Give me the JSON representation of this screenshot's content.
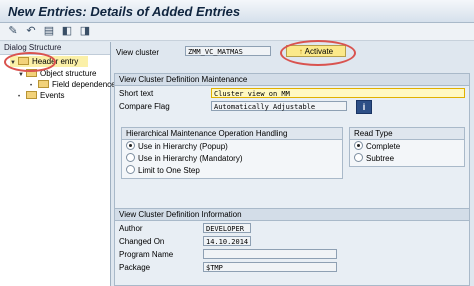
{
  "window": {
    "title": "New Entries: Details of Added Entries"
  },
  "toolbar": {
    "icons": [
      "pencil-icon",
      "back-icon",
      "pages-icon",
      "prev-icon",
      "next-icon"
    ]
  },
  "dialog_structure": {
    "title": "Dialog Structure",
    "items": [
      {
        "label": "Header entry"
      },
      {
        "label": "Object structure"
      },
      {
        "label": "Field dependence"
      },
      {
        "label": "Events"
      }
    ]
  },
  "view_cluster": {
    "label": "View cluster",
    "value": "ZMM_VC_MATMAS",
    "activate_label": "Activate"
  },
  "maintenance": {
    "title": "View Cluster Definition Maintenance",
    "short_text_label": "Short text",
    "short_text_value": "Cluster view on MM",
    "compare_flag_label": "Compare Flag",
    "compare_flag_value": "Automatically Adjustable"
  },
  "hierarchical": {
    "title": "Hierarchical Maintenance Operation Handling",
    "options": [
      {
        "label": "Use in Hierarchy (Popup)",
        "selected": true
      },
      {
        "label": "Use in Hierarchy (Mandatory)",
        "selected": false
      },
      {
        "label": "Limit to One Step",
        "selected": false
      }
    ]
  },
  "read_type": {
    "title": "Read Type",
    "options": [
      {
        "label": "Complete",
        "selected": true
      },
      {
        "label": "Subtree",
        "selected": false
      }
    ]
  },
  "information": {
    "title": "View Cluster Definition Information",
    "author_label": "Author",
    "author_value": "DEVELOPER",
    "changed_on_label": "Changed On",
    "changed_on_value": "14.10.2014",
    "program_name_label": "Program Name",
    "program_name_value": "",
    "package_label": "Package",
    "package_value": "$TMP"
  }
}
